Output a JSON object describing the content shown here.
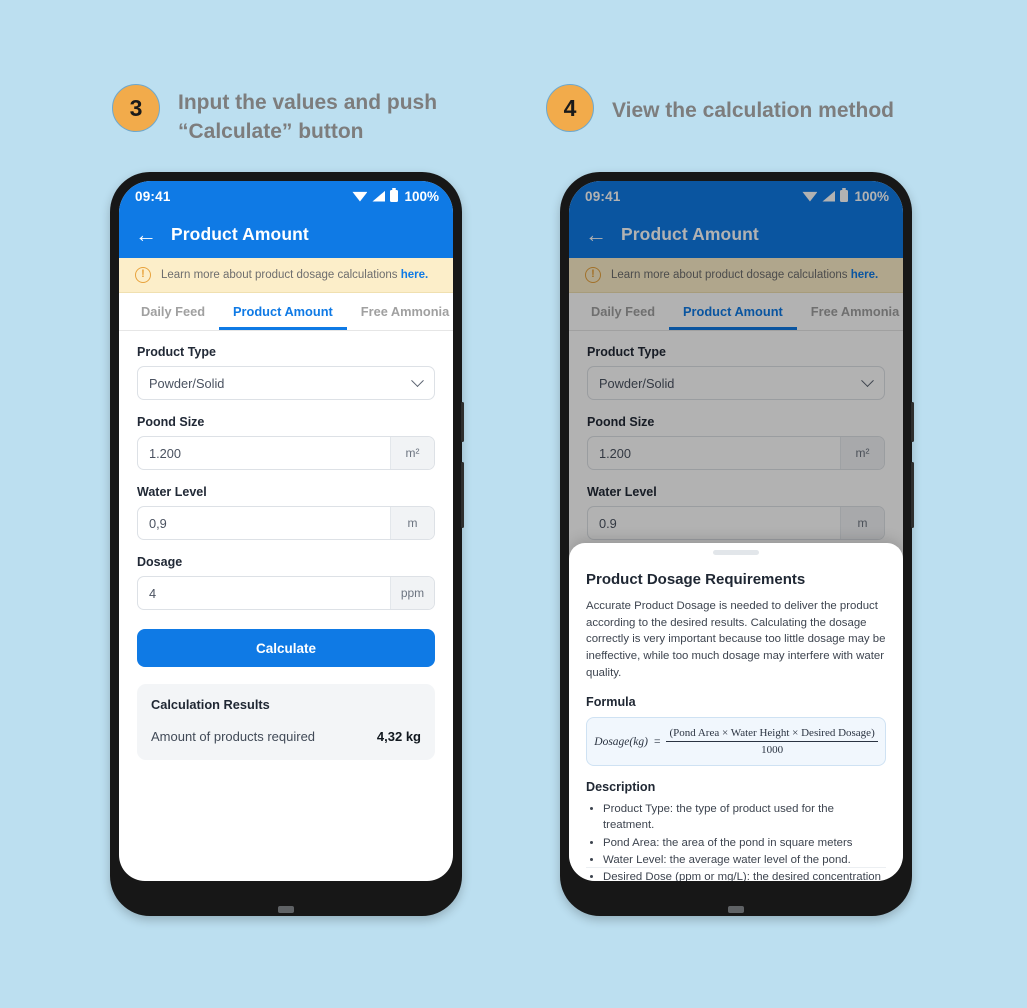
{
  "background_color": "#bcdff0",
  "accent_color": "#0f7ae5",
  "badge_color": "#f2ab4b",
  "steps": [
    {
      "number": "3",
      "title": "Input the values and push “Calculate” button"
    },
    {
      "number": "4",
      "title": "View the calculation method"
    }
  ],
  "phone_left": {
    "status_bar": {
      "clock": "09:41",
      "battery_percent": "100%",
      "icons": [
        "wifi-icon",
        "signal-icon",
        "battery-icon"
      ]
    },
    "app_bar": {
      "back_icon": "back-arrow-icon",
      "title": "Product Amount"
    },
    "banner": {
      "icon": "alert-circle-icon",
      "text": "Learn more about product dosage calculations",
      "link": "here."
    },
    "tabs": [
      {
        "label": "Daily Feed",
        "active": false
      },
      {
        "label": "Product Amount",
        "active": true
      },
      {
        "label": "Free Ammonia",
        "active": false
      }
    ],
    "form": {
      "product_type": {
        "label": "Product Type",
        "value": "Powder/Solid",
        "icon": "chevron-down-icon"
      },
      "pond_size": {
        "label": "Poond Size",
        "value": "1.200",
        "unit": "m²"
      },
      "water_level": {
        "label": "Water Level",
        "value": "0,9",
        "unit": "m"
      },
      "dosage": {
        "label": "Dosage",
        "value": "4",
        "unit": "ppm"
      },
      "calculate_button": "Calculate"
    },
    "results": {
      "title": "Calculation Results",
      "row_label": "Amount of products required",
      "row_value": "4,32 kg"
    }
  },
  "phone_right": {
    "status_bar": {
      "clock": "09:41",
      "battery_percent": "100%",
      "icons": [
        "wifi-icon",
        "signal-icon",
        "battery-icon"
      ]
    },
    "app_bar": {
      "back_icon": "back-arrow-icon",
      "title": "Product Amount"
    },
    "banner": {
      "icon": "alert-circle-icon",
      "text": "Learn more about product dosage calculations",
      "link": "here."
    },
    "tabs": [
      {
        "label": "Daily Feed",
        "active": false
      },
      {
        "label": "Product Amount",
        "active": true
      },
      {
        "label": "Free Ammonia",
        "active": false
      }
    ],
    "form": {
      "product_type": {
        "label": "Product Type",
        "value": "Powder/Solid",
        "icon": "chevron-down-icon"
      },
      "pond_size": {
        "label": "Poond Size",
        "value": "1.200",
        "unit": "m²"
      },
      "water_level": {
        "label": "Water Level",
        "value": "0.9",
        "unit": "m"
      }
    },
    "sheet": {
      "title": "Product Dosage Requirements",
      "body": "Accurate Product Dosage is needed to deliver the product according to the desired results. Calculating the dosage correctly is very important because too little dosage may be ineffective, while too much dosage may interfere with water quality.",
      "formula_heading": "Formula",
      "formula": {
        "lhs": "Dosage(kg)",
        "equals": "=",
        "numerator": "(Pond Area × Water Height × Desired Dosage)",
        "denominator": "1000"
      },
      "description_heading": "Description",
      "bullets": [
        "Product Type: the type of product used for the treatment.",
        "Pond Area: the area of the pond in square meters",
        "Water Level: the average water level of the pond.",
        "Desired Dose (ppm or mg/L): the desired concentration of the product."
      ]
    }
  }
}
